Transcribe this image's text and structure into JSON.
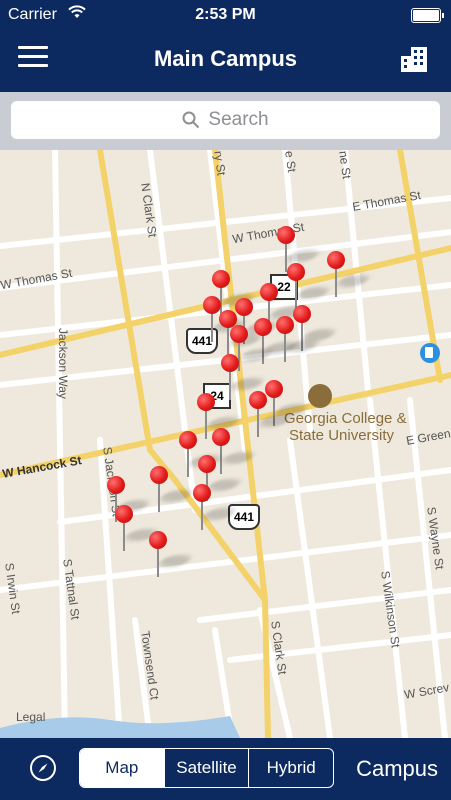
{
  "status": {
    "carrier": "Carrier",
    "time": "2:53 PM"
  },
  "nav": {
    "title": "Main Campus"
  },
  "search": {
    "placeholder": "Search"
  },
  "map": {
    "streets": {
      "n_clark": "N Clark St",
      "w_thomas_top": "W Thomas St",
      "e_thomas": "E Thomas St",
      "w_thomas_left": "W Thomas St",
      "jackson_way": "Jackson Way",
      "w_hancock": "W Hancock St",
      "s_jackson": "S Jackson St",
      "s_irwin": "S Irwin St",
      "s_tattnal": "S Tattnal St",
      "townsend": "Townsend Ct",
      "s_clark": "S Clark St",
      "s_wilkinson": "S Wilkinson St",
      "s_wayne": "S Wayne St",
      "e_greene": "E Green",
      "w_screven": "W Screv",
      "ry_st": "ry St",
      "ne_st": "ne St",
      "e_st": "e St"
    },
    "shields": {
      "us441_a": "441",
      "us441_b": "441",
      "sr22": "22",
      "sr24": "24"
    },
    "poi": {
      "name_line1": "Georgia College &",
      "name_line2": "State University"
    },
    "legal": "Legal"
  },
  "tabbar": {
    "segments": [
      "Map",
      "Satellite",
      "Hybrid"
    ],
    "selected": "Map",
    "campus_label": "Campus"
  },
  "colors": {
    "navy": "#0c2a5f",
    "pin_red": "#e21b1b",
    "road_yellow": "#f4d26a"
  }
}
